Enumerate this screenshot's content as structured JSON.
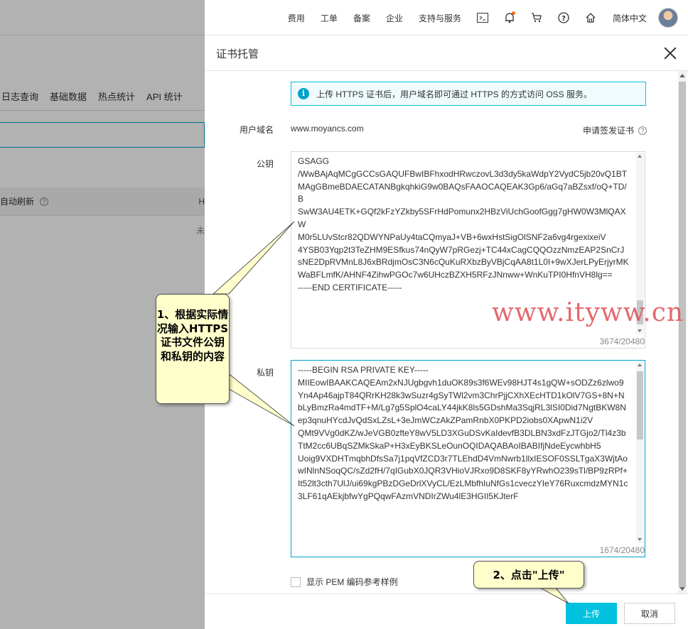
{
  "topbar": {
    "nav": [
      "费用",
      "工单",
      "备案",
      "企业",
      "支持与服务"
    ],
    "icons": [
      "terminal-icon",
      "bell-icon",
      "cart-icon",
      "help-icon",
      "home-icon"
    ],
    "language": "简体中文"
  },
  "background": {
    "tabs": [
      "日志查询",
      "基础数据",
      "热点统计",
      "API 统计"
    ],
    "row_label": "自动刷新",
    "row_right": "H",
    "side_char": "未"
  },
  "dialog": {
    "title": "证书托管",
    "info_text": "上传 HTTPS 证书后，用户域名即可通过 HTTPS 的方式访问 OSS 服务。",
    "domain_label": "用户域名",
    "domain_value": "www.moyancs.com",
    "apply_link": "申请签发证书",
    "public_key_label": "公钥",
    "public_key_text": "GSAGG\n/WwBAjAqMCgGCCsGAQUFBwIBFhxodHRwczovL3d3dy5kaWdpY2VydC5jb20vQ1BT\nMAgGBmeBDAECATANBgkqhkiG9w0BAQsFAAOCAQEAK3Gp6/aGq7aBZsxf/oQ+TD/B\nSwW3AU4ETK+GQf2kFzYZkby5SFrHdPomunx2HBzViUchGoofGgg7gHW0W3MlQAXW\nM0r5LUvStcr82QDWYNPaUy4taCQmyaJ+VB+6wxHstSigOlSNF2a6vg4rgexixeiV\n4YSB03Yqp2t3TeZHM9ESfkus74nQyW7pRGezj+TC44xCagCQQOzzNmzEAP2SnCrJ\nsNE2DpRVMnL8J6xBRdjmOsC3N6cQuKuRXbzByVBjCqAA8t1L0I+9wXJerLPyErjyrMKWaBFLmfK/AHNF4ZihwPGOc7w6UHczBZXH5RFzJNnww+WnKuTPI0HfnVH8lg==\n-----END CERTIFICATE-----",
    "public_key_counter": "3674/20480",
    "private_key_label": "私钥",
    "private_key_text": "-----BEGIN RSA PRIVATE KEY-----\nMIIEowIBAAKCAQEAm2xNJUgbgvh1duOK89s3f6WEv98HJT4s1gQW+sODZz6zlwo9\nYn4Ap46ajpT84QRrKH28k3wSuzr4gSyTWl2vm3ChrPjjCXhXEcHTD1kOlV7GS+8N+NbLyBmzRa4mdTF+M/Lg7g5SplO4caLY44jkK8ls5GDshMa3SqjRL3lSI0Did7NgtBKW8Nep3qnuHYcdJvQdSxLZsL+3eJmWCzAkZPamRnbX0PKPD2iobs0XApwN1i2V\nQMt9VVg0dKZ/wJeVGB0zfteY8wV5LD3XGuDSvKaIdevfB3DLBN3xdFzJTGjo2/Tl4z3bTtM2cc6UBqSZMkSkaP+H3xEyBKSLeOunOQIDAQABAoIBABIfjNdeEycwhbH5\nUoig9VXDHTmqbhDfsSa7j1pqVfZCD3r7TLEhdD4VmNwrb1llxIESOF0SSLTgaX3WjtAowINlnNSoqQC/sZd2fH/7qIGubX0JQR3VHioVJRxo9D8SKF8yYRwhO239sTl/BP9zRPf+It52lt3cth7UlJ/ui69kgPBzDGeDrlXVyCL/EzLMbfhIuNfGs1cveczYIeY76RuxcmdzMYN1c3LF61qAEkjbfwYgPQqwFAzmVNDIrZWu4lE3HGII5KJterF",
    "private_key_counter": "1674/20480",
    "pem_label": "显示 PEM 编码参考样例",
    "upload_button": "上传",
    "cancel_button": "取消"
  },
  "annotations": {
    "callout1": "1、根据实际情况输入HTTPS证书文件公钥和私钥的内容",
    "callout2": "2、点击\"上传\"",
    "watermark": "www.ityww.cn"
  }
}
